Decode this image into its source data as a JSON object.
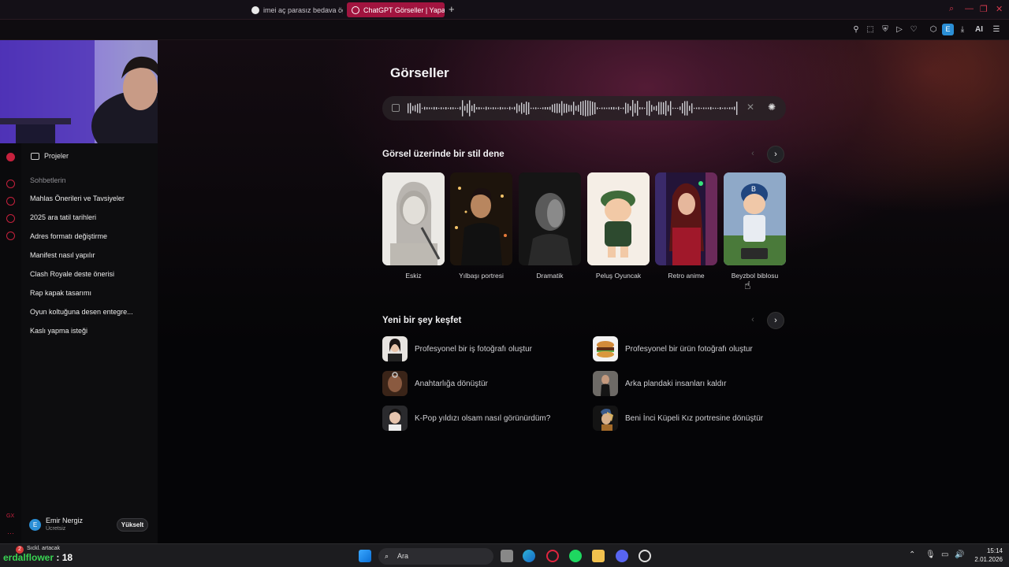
{
  "browser": {
    "tabs": [
      {
        "label": "imei aç parasız bedava öğ",
        "active": false
      },
      {
        "label": "ChatGPT Görseller | Yapay",
        "active": true
      }
    ],
    "new_tab": "+",
    "profile_letter": "E",
    "ai_label": "AI"
  },
  "sidebar": {
    "projects_label": "Projeler",
    "chats_heading": "Sohbetlerin",
    "items": [
      "Mahlas Önerileri ve Tavsiyeler",
      "2025 ara tatil tarihleri",
      "Adres formatı değiştirme",
      "Manifest nasıl yapılır",
      "Clash Royale deste önerisi",
      "Rap kapak tasarımı",
      "Oyun koltuğuna desen entegre...",
      "Kaslı yapma isteği"
    ],
    "user": {
      "initial": "E",
      "name": "Emir Nergiz",
      "plan": "Ücretsiz"
    },
    "upgrade_label": "Yükselt"
  },
  "main": {
    "title": "Görseller",
    "style_section": "Görsel üzerinde bir stil dene",
    "styles": [
      "Eskiz",
      "Yılbaşı portresi",
      "Dramatik",
      "Peluş Oyuncak",
      "Retro anime",
      "Beyzbol biblosu"
    ],
    "explore_section": "Yeni bir şey keşfet",
    "explore": [
      "Profesyonel bir iş fotoğrafı oluştur",
      "Profesyonel bir ürün fotoğrafı oluştur",
      "Anahtarlığa dönüştür",
      "Arka plandaki insanları kaldır",
      "K-Pop yıldızı olsam nasıl görünürdüm?",
      "Beni İnci Küpeli Kız portresine dönüştür"
    ]
  },
  "taskbar": {
    "search_label": "Ara",
    "time": "15:14",
    "date": "2.01.2026",
    "notification": "Sıckl. artacak",
    "notification_count": "2"
  },
  "overlay": {
    "streamer_name": "erdalflower",
    "streamer_suffix": ": 18"
  }
}
